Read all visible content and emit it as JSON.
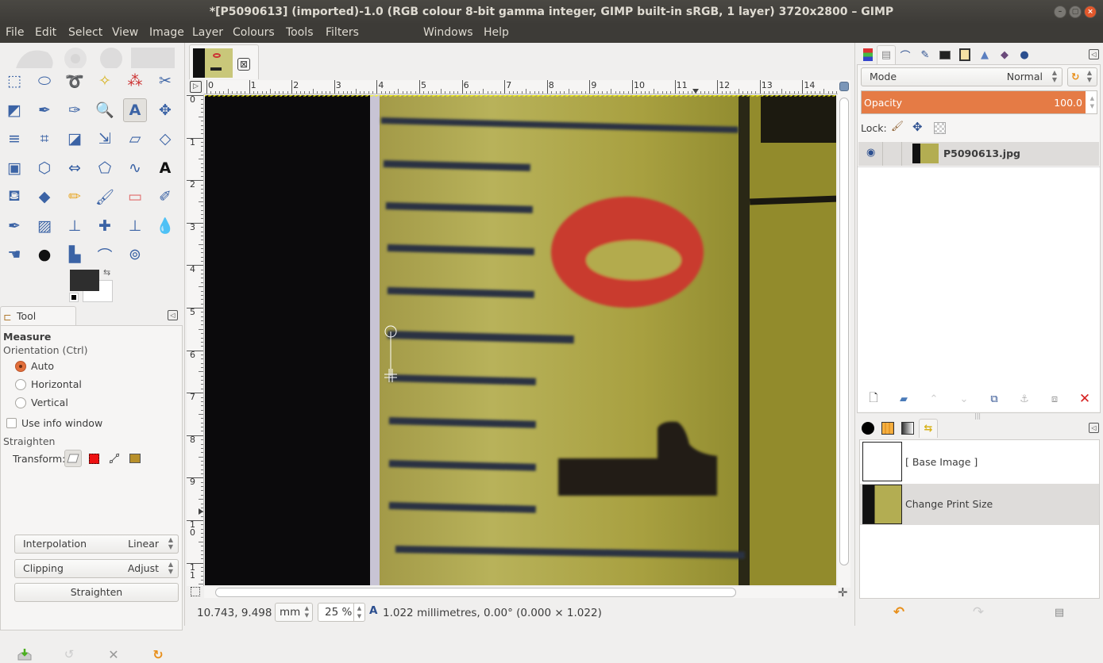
{
  "window": {
    "title": "*[P5090613] (imported)-1.0 (RGB colour 8-bit gamma integer, GIMP built-in sRGB, 1 layer) 3720x2800 – GIMP",
    "controls": [
      "minimize",
      "maximize",
      "close"
    ]
  },
  "menubar": [
    "File",
    "Edit",
    "Select",
    "View",
    "Image",
    "Layer",
    "Colours",
    "Tools",
    "Filters",
    "Windows",
    "Help"
  ],
  "toolbox": {
    "tools": [
      "rect-select",
      "ellipse-select",
      "free-select",
      "fuzzy-select",
      "select-by-color",
      "scissors-select",
      "foreground-select",
      "paths",
      "color-picker",
      "zoom",
      "measure",
      "move",
      "align",
      "crop",
      "rotate",
      "scale",
      "shear",
      "perspective",
      "unified-transform",
      "3d-transform",
      "flip",
      "cage-transform",
      "warp-transform",
      "text",
      "bucket-fill",
      "gradient",
      "pencil",
      "paintbrush",
      "eraser",
      "airbrush",
      "ink",
      "mypaint-brush",
      "clone",
      "heal",
      "perspective-clone",
      "blur-sharpen",
      "smudge",
      "dodge-burn",
      "levels",
      "curves",
      "gegl-operation"
    ],
    "active_tool": "measure",
    "foreground_color": "#2e2e2e",
    "background_color": "#ffffff"
  },
  "tool_options": {
    "tab_label": "Tool Options",
    "tool_name": "Measure",
    "orientation_label": "Orientation  (Ctrl)",
    "orientation_options": [
      "Auto",
      "Horizontal",
      "Vertical"
    ],
    "orientation_selected": "Auto",
    "use_info_window_label": "Use info window",
    "use_info_window_checked": false,
    "straighten_label": "Straighten",
    "transform_label": "Transform:",
    "interpolation_label": "Interpolation",
    "interpolation_value": "Linear",
    "clipping_label": "Clipping",
    "clipping_value": "Adjust",
    "straighten_button": "Straighten",
    "bottom_buttons": [
      "save-options",
      "restore-options",
      "delete-options",
      "reset-options"
    ]
  },
  "image_window": {
    "h_ruler_labels": [
      "0",
      "1",
      "2",
      "3",
      "4",
      "5",
      "6",
      "7",
      "8",
      "9",
      "10",
      "11",
      "12",
      "13",
      "14"
    ],
    "v_ruler_labels": [
      "0",
      "1",
      "2",
      "3",
      "4",
      "5",
      "6",
      "7",
      "8",
      "9",
      "10",
      "11"
    ],
    "status": {
      "coordinates": "10.743, 9.498",
      "unit": "mm",
      "zoom": "25 %",
      "measure_info": "1.022 millimetres, 0.00° (0.000 × 1.022)"
    }
  },
  "layers_panel": {
    "mode_label": "Mode",
    "mode_value": "Normal",
    "opacity_label": "Opacity",
    "opacity_value": "100.0",
    "opacity_color": "#e57b45",
    "lock_label": "Lock:",
    "layers": [
      {
        "name": "P5090613.jpg",
        "visible": true
      }
    ]
  },
  "undo_history": {
    "items": [
      {
        "label": "[ Base Image ]"
      },
      {
        "label": "Change Print Size",
        "selected": true
      }
    ]
  }
}
